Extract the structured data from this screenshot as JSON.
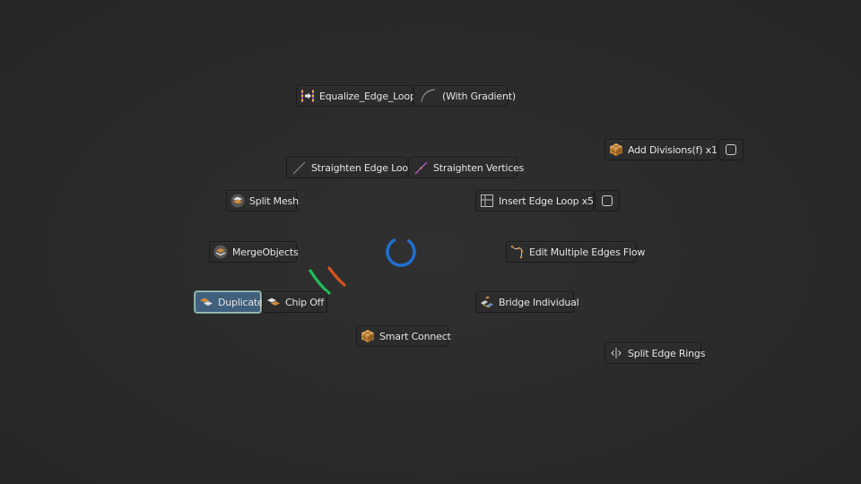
{
  "pie_menu": {
    "items": {
      "equalize_edge_loop": "Equalize_Edge_Loop",
      "with_gradient": "(With Gradient)",
      "add_divisions": "Add Divisions(f) x1",
      "straighten_edge_loop": "Straighten Edge Loop",
      "straighten_vertices": "Straighten Vertices",
      "split_mesh": "Split Mesh",
      "insert_edge_loop": "Insert Edge Loop x5",
      "merge_objects": "MergeObjects",
      "edit_multiple_edges_flow": "Edit Multiple Edges Flow",
      "duplicate": "Duplicate",
      "chip_off": "Chip Off",
      "bridge_individual": "Bridge Individual",
      "smart_connect": "Smart Connect",
      "split_edge_rings": "Split Edge Rings"
    },
    "checkboxes": {
      "add_divisions_checked": false,
      "insert_edge_loop_checked": false
    },
    "active_item": "duplicate",
    "colors": {
      "center_ring": "#1f6fd0",
      "direction_green": "#1fbf5a",
      "direction_orange": "#d4541c",
      "active_fill": "#41607e",
      "active_border": "#a7c4b7"
    }
  }
}
